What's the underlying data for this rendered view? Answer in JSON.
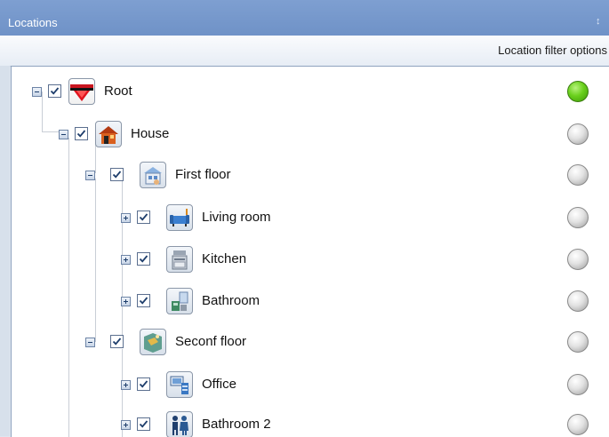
{
  "panel": {
    "title": "Locations",
    "pin_glyph": "↕",
    "filter_label": "Location filter options"
  },
  "tree": {
    "items": [
      {
        "label": "Root",
        "icon": "root-flag-icon",
        "checked": true,
        "expander": "collapse",
        "status": "green"
      },
      {
        "label": "House",
        "icon": "house-icon",
        "checked": true,
        "expander": "collapse",
        "status": "grey"
      },
      {
        "label": "First floor",
        "icon": "floor-icon",
        "checked": true,
        "expander": "collapse",
        "status": "grey"
      },
      {
        "label": "Living room",
        "icon": "sofa-icon",
        "checked": true,
        "expander": "expand",
        "status": "grey"
      },
      {
        "label": "Kitchen",
        "icon": "kitchen-icon",
        "checked": true,
        "expander": "expand",
        "status": "grey"
      },
      {
        "label": "Bathroom",
        "icon": "bathroom-icon",
        "checked": true,
        "expander": "expand",
        "status": "grey"
      },
      {
        "label": "Seconf floor",
        "icon": "floor-icon",
        "checked": true,
        "expander": "collapse",
        "status": "grey"
      },
      {
        "label": "Office",
        "icon": "office-icon",
        "checked": true,
        "expander": "expand",
        "status": "grey"
      },
      {
        "label": "Bathroom 2",
        "icon": "people-icon",
        "checked": true,
        "expander": "expand",
        "status": "grey"
      }
    ]
  },
  "colors": {
    "status_on": "#6ad01c",
    "status_off": "#d9d9d9",
    "title_bar": "#7497cb"
  }
}
